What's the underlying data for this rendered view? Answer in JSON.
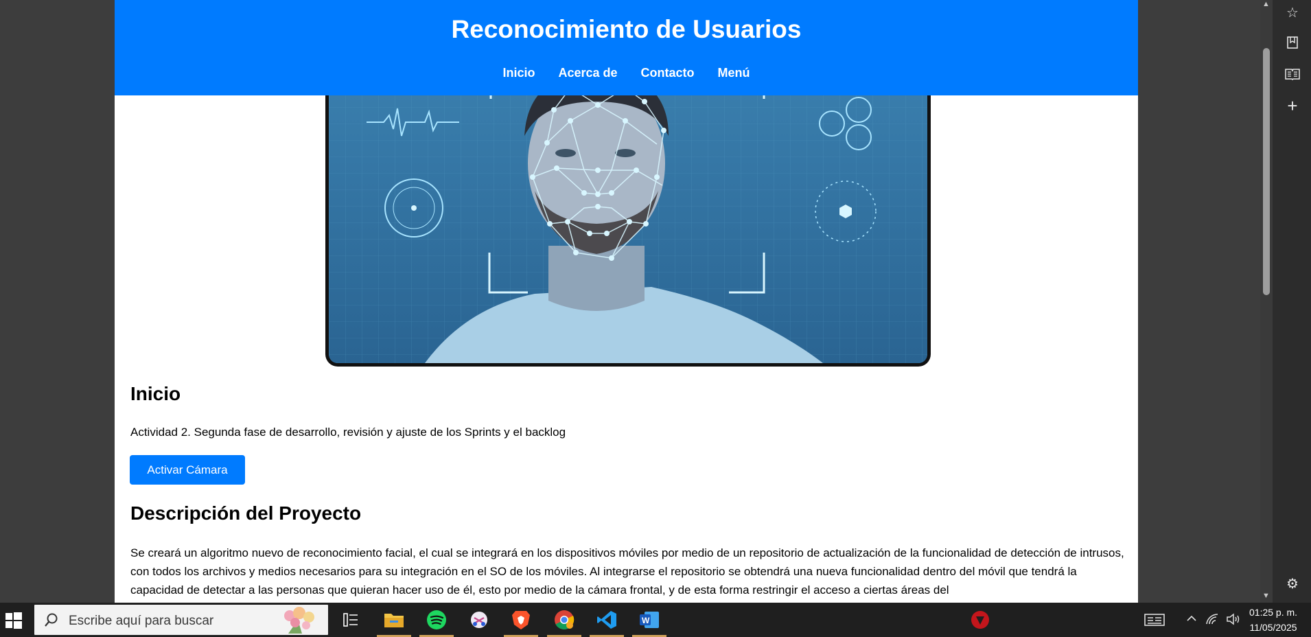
{
  "site": {
    "title": "Reconocimiento de Usuarios",
    "nav": [
      "Inicio",
      "Acerca de",
      "Contacto",
      "Menú"
    ]
  },
  "main": {
    "heading": "Inicio",
    "activity": "Actividad 2. Segunda fase de desarrollo, revisión y ajuste de los Sprints y el backlog",
    "camera_button": "Activar Cámara",
    "description_heading": "Descripción del Proyecto",
    "description": "Se creará un algoritmo nuevo de reconocimiento facial, el cual se integrará en los dispositivos móviles por medio de un repositorio de actualización de la funcionalidad de detección de intrusos, con todos los archivos y medios necesarios para su integración en el SO de los móviles. Al integrarse el repositorio se obtendrá una nueva funcionalidad dentro del móvil que tendrá la capacidad de detectar a las personas que quieran hacer uso de él, esto por medio de la cámara frontal, y de esta forma restringir el acceso a ciertas áreas del"
  },
  "browser_sidebar": {
    "icons": [
      "star-sparkle-icon",
      "bookmark-icon",
      "reading-list-icon",
      "add-icon",
      "settings-icon"
    ]
  },
  "taskbar": {
    "search_placeholder": "Escribe aquí para buscar",
    "apps": [
      "task-view",
      "file-explorer",
      "spotify",
      "snipping-tool",
      "brave",
      "chrome",
      "vscode",
      "word",
      "app-red"
    ],
    "time": "01:25 p. m.",
    "date": "11/05/2025"
  },
  "colors": {
    "header_bg": "#007bff",
    "button_bg": "#007bff",
    "taskbar_bg": "#1f1f1f"
  }
}
